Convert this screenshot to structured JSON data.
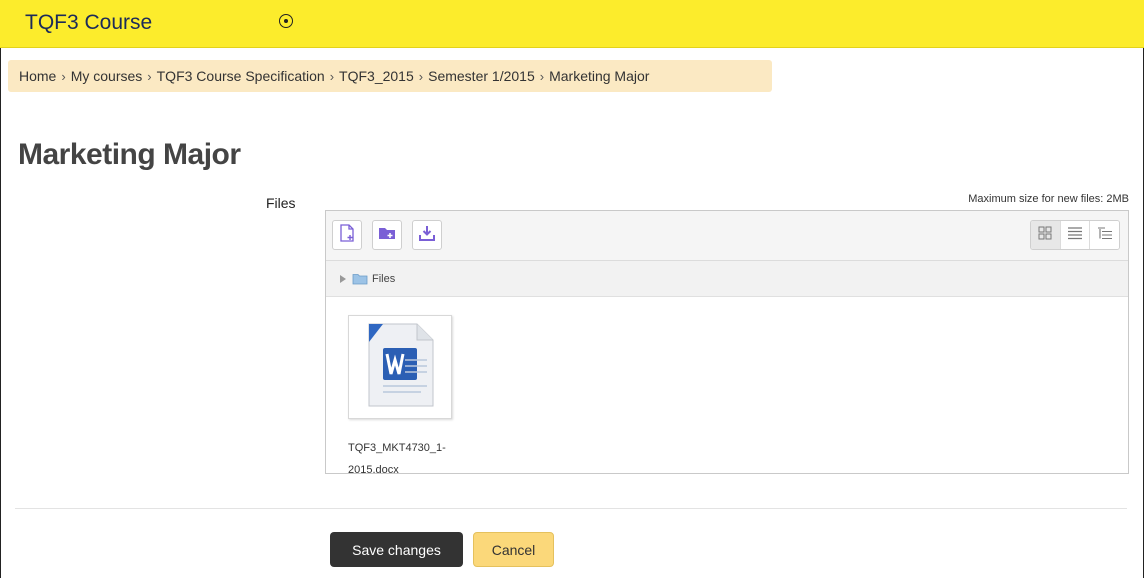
{
  "header": {
    "site_title": "TQF3 Course"
  },
  "breadcrumb": [
    "Home",
    "My courses",
    "TQF3 Course Specification",
    "TQF3_2015",
    "Semester 1/2015",
    "Marketing Major"
  ],
  "page": {
    "title": "Marketing Major"
  },
  "form": {
    "files_label": "Files",
    "max_size": "Maximum size for new files: 2MB"
  },
  "filemanager": {
    "toolbar": {
      "icons": [
        "add-file-icon",
        "create-folder-icon",
        "download-all-icon"
      ],
      "views": [
        "view-icons-icon",
        "view-details-icon",
        "view-tree-icon"
      ]
    },
    "path_label": "Files",
    "files": [
      {
        "name": "TQF3_MKT4730_1-2015.docx",
        "icon": "word-document-icon"
      }
    ]
  },
  "buttons": {
    "save": "Save changes",
    "cancel": "Cancel"
  },
  "colors": {
    "header_bg": "#fcec2c",
    "breadcrumb_bg": "#fbe9c3",
    "accent_purple": "#7a5fd6",
    "save_bg": "#333333",
    "cancel_bg": "#fbd87a"
  }
}
